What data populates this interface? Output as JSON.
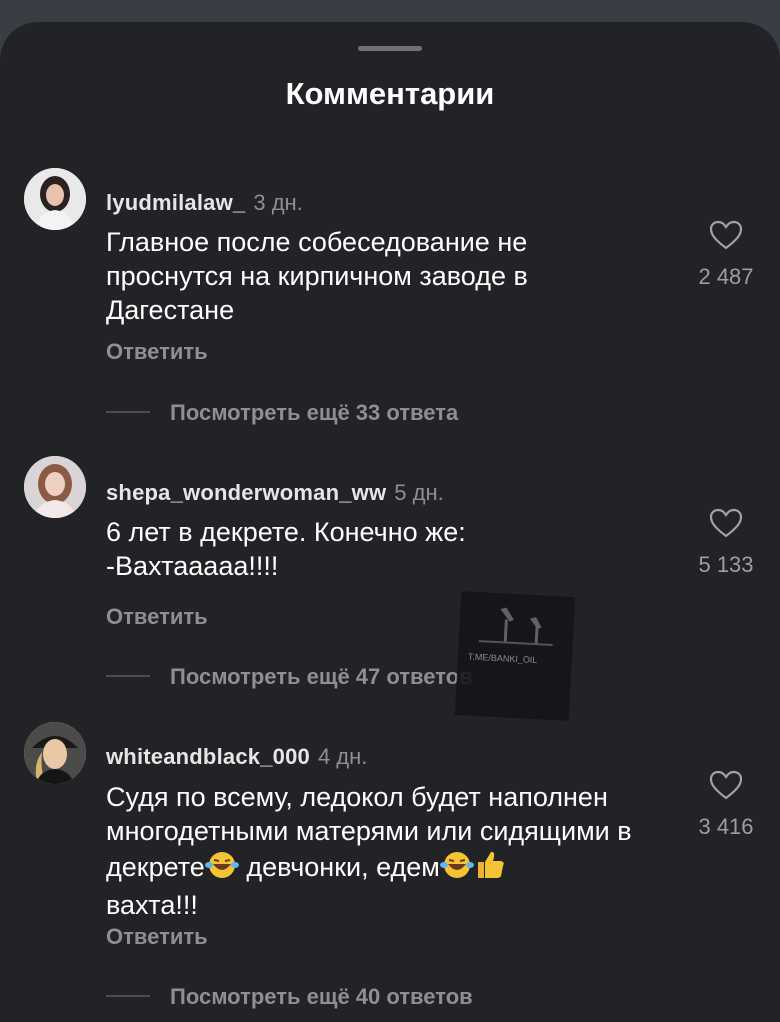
{
  "header": {
    "title": "Комментарии"
  },
  "comments": [
    {
      "username": "lyudmilalaw_",
      "time": "3 дн.",
      "text": "Главное после собеседование не проснутся на кирпичном заводе в Дагестане",
      "likes": "2 487",
      "reply_label": "Ответить",
      "more_replies": "Посмотреть ещё 33 ответа"
    },
    {
      "username": "shepa_wonderwoman_ww",
      "time": "5 дн.",
      "text_line1": "6 лет в декрете. Конечно же:",
      "text_line2": "-Вахтааааа!!!!",
      "likes": "5 133",
      "reply_label": "Ответить",
      "more_replies": "Посмотреть ещё 47 ответов"
    },
    {
      "username": "whiteandblack_000",
      "time": "4 дн.",
      "text_part1": "Судя по всему, ледокол будет наполнен многодетными матерями или сидящими в декрете",
      "text_part2": " девчонки, едем",
      "text_part3": "вахта!!!",
      "likes": "3 416",
      "reply_label": "Ответить",
      "more_replies": "Посмотреть ещё 40 ответов"
    }
  ],
  "watermark": {
    "text": "T.ME/BANKI_OIL"
  }
}
